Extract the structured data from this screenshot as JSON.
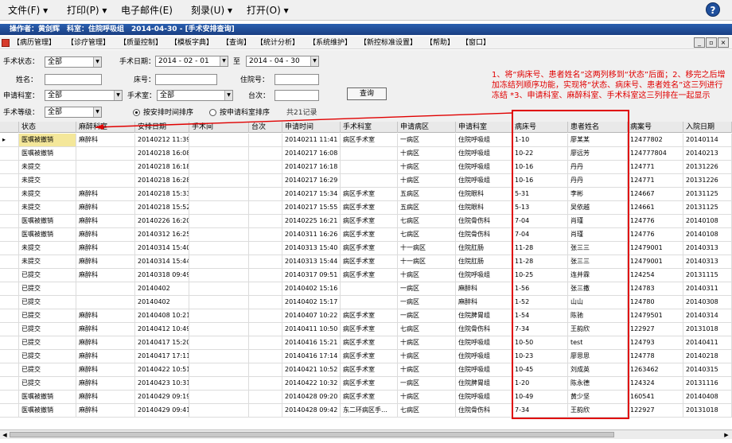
{
  "top_menu": [
    "文件(F) ▾",
    "打印(P) ▾",
    "电子邮件(E)",
    "刻录(U) ▾",
    "打开(O) ▾"
  ],
  "help_symbol": "?",
  "title_bar": "操作者：黄剑辉　科室：住院呼吸组　2014-04-30 - [手术安排查询]",
  "app_menu": [
    "【病历管理】",
    "【诊疗管理】",
    "【质量控制】",
    "【模板字典】",
    "【查询】",
    "【统计分析】",
    "【系统维护】",
    "【新控标准设置】",
    "【帮助】",
    "【窗口】"
  ],
  "window_controls": [
    "_",
    "▫",
    "×"
  ],
  "form": {
    "status_label": "手术状态：",
    "status_value": "全部",
    "date_label": "手术日期：",
    "date_from": "2014 - 02 - 01",
    "to_label": "至",
    "date_to": "2014 - 04 - 30",
    "name_label": "姓名：",
    "name_value": "",
    "bed_label": "床号：",
    "bed_value": "",
    "inpatient_label": "住院号：",
    "inpatient_value": "",
    "dept_label": "申请科室：",
    "dept_value": "全部",
    "op_room_label": "手术室：",
    "op_room_value": "全部",
    "table_label": "台次：",
    "table_value": "",
    "level_label": "手术等级：",
    "level_value": "全部",
    "radio1": "按安排时间排序",
    "radio2": "按申请科室排序",
    "count": "共21记录",
    "query_button": "查询"
  },
  "annotation": "1、将“病床号、患者姓名”这两列移到“状态”后面；2、移完之后增加冻结列顺序功能，实现将“状态、病床号、患者姓名”这三列进行冻结 *3、申请科室、麻醉科室、手术科室这三列排在一起显示",
  "columns": [
    "状态",
    "麻醉科室",
    "安排日期",
    "手术间",
    "台次",
    "申请时间",
    "手术科室",
    "申请病区",
    "申请科室",
    "病床号",
    "患者姓名",
    "病案号",
    "入院日期"
  ],
  "rows": [
    [
      "医嘱被撤销",
      "麻醉科",
      "20140212 11:39",
      "",
      "",
      "20140211 11:41",
      "病区手术室",
      "一病区",
      "住院呼吸组",
      "1-10",
      "廖某某",
      "12477802",
      "20140114"
    ],
    [
      "医嘱被撤销",
      "",
      "20140218 16:08",
      "",
      "",
      "20140217 16:08",
      "",
      "十病区",
      "住院呼吸组",
      "10-22",
      "廖远芳",
      "124777804",
      "20140213"
    ],
    [
      "未提交",
      "",
      "20140218 16:18",
      "",
      "",
      "20140217 16:18",
      "",
      "十病区",
      "住院呼吸组",
      "10-16",
      "丹丹",
      "124771",
      "20131226"
    ],
    [
      "未提交",
      "",
      "20140218 16:28",
      "",
      "",
      "20140217 16:29",
      "",
      "十病区",
      "住院呼吸组",
      "10-16",
      "丹丹",
      "124771",
      "20131226"
    ],
    [
      "未提交",
      "麻醉科",
      "20140218 15:33",
      "",
      "",
      "20140217 15:34",
      "病区手术室",
      "五病区",
      "住院眼科",
      "5-31",
      "李彬",
      "124667",
      "20131125"
    ],
    [
      "未提交",
      "麻醉科",
      "20140218 15:52",
      "",
      "",
      "20140217 15:55",
      "病区手术室",
      "五病区",
      "住院眼科",
      "5-13",
      "吴依越",
      "124661",
      "20131125"
    ],
    [
      "医嘱被撤销",
      "麻醉科",
      "20140226 16:20",
      "",
      "",
      "20140225 16:21",
      "病区手术室",
      "七病区",
      "住院骨伤科",
      "7-04",
      "肖瑾",
      "124776",
      "20140108"
    ],
    [
      "医嘱被撤销",
      "麻醉科",
      "20140312 16:25",
      "",
      "",
      "20140311 16:26",
      "病区手术室",
      "七病区",
      "住院骨伤科",
      "7-04",
      "肖瑾",
      "124776",
      "20140108"
    ],
    [
      "未提交",
      "麻醉科",
      "20140314 15:40",
      "",
      "",
      "20140313 15:40",
      "病区手术室",
      "十一病区",
      "住院肛肠",
      "11-28",
      "张三三",
      "12479001",
      "20140313"
    ],
    [
      "未提交",
      "麻醉科",
      "20140314 15:44",
      "",
      "",
      "20140313 15:44",
      "病区手术室",
      "十一病区",
      "住院肛肠",
      "11-28",
      "张三三",
      "12479001",
      "20140313"
    ],
    [
      "已提交",
      "麻醉科",
      "20140318 09:49",
      "",
      "",
      "20140317 09:51",
      "病区手术室",
      "十病区",
      "住院呼吸组",
      "10-25",
      "连并霖",
      "124254",
      "20131115"
    ],
    [
      "已提交",
      "",
      "20140402",
      "",
      "",
      "20140402 15:16",
      "",
      "一病区",
      "麻醉科",
      "1-56",
      "张三撒",
      "124783",
      "20140311"
    ],
    [
      "已提交",
      "",
      "20140402",
      "",
      "",
      "20140402 15:17",
      "",
      "一病区",
      "麻醉科",
      "1-52",
      "山山",
      "124780",
      "20140308"
    ],
    [
      "已提交",
      "麻醉科",
      "20140408 10:21",
      "",
      "",
      "20140407 10:22",
      "病区手术室",
      "一病区",
      "住院脾胃组",
      "1-54",
      "陈驰",
      "12479501",
      "20140314"
    ],
    [
      "已提交",
      "麻醉科",
      "20140412 10:49",
      "",
      "",
      "20140411 10:50",
      "病区手术室",
      "七病区",
      "住院骨伤科",
      "7-34",
      "王韵欣",
      "122927",
      "20131018"
    ],
    [
      "已提交",
      "麻醉科",
      "20140417 15:20",
      "",
      "",
      "20140416 15:21",
      "病区手术室",
      "十病区",
      "住院呼吸组",
      "10-50",
      "test",
      "124793",
      "20140411"
    ],
    [
      "已提交",
      "麻醉科",
      "20140417 17:11",
      "",
      "",
      "20140416 17:14",
      "病区手术室",
      "十病区",
      "住院呼吸组",
      "10-23",
      "廖思思",
      "124778",
      "20140218"
    ],
    [
      "已提交",
      "麻醉科",
      "20140422 10:51",
      "",
      "",
      "20140421 10:52",
      "病区手术室",
      "十病区",
      "住院呼吸组",
      "10-45",
      "刘成英",
      "1263462",
      "20140315"
    ],
    [
      "已提交",
      "麻醉科",
      "20140423 10:31",
      "",
      "",
      "20140422 10:32",
      "病区手术室",
      "一病区",
      "住院脾胃组",
      "1-20",
      "陈永德",
      "124324",
      "20131116"
    ],
    [
      "医嘱被撤销",
      "麻醉科",
      "20140429 09:19",
      "",
      "",
      "20140428 09:20",
      "病区手术室",
      "十病区",
      "住院呼吸组",
      "10-49",
      "黄少坚",
      "160541",
      "20140408"
    ],
    [
      "医嘱被撤销",
      "麻醉科",
      "20140429 09:41",
      "",
      "",
      "20140428 09:42",
      "东二环病区手…",
      "七病区",
      "住院骨伤科",
      "7-34",
      "王韵欣",
      "122927",
      "20131018"
    ]
  ],
  "colors": {
    "annotation": "#e00000",
    "title_bar": "#1f4f9c",
    "selected_cell": "#f4e79a"
  }
}
